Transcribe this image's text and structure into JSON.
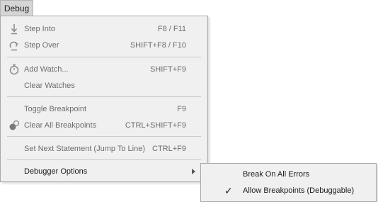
{
  "menubar": {
    "title": "Debug"
  },
  "menu": {
    "items": [
      {
        "label": "Step Into",
        "shortcut": "F8 / F11",
        "icon": "step-into-icon",
        "enabled": false
      },
      {
        "label": "Step Over",
        "shortcut": "SHIFT+F8 / F10",
        "icon": "step-over-icon",
        "enabled": false
      },
      {
        "label": "Add Watch...",
        "shortcut": "SHIFT+F9",
        "icon": "stopwatch-icon",
        "enabled": false
      },
      {
        "label": "Clear Watches",
        "shortcut": "",
        "icon": "",
        "enabled": false
      },
      {
        "label": "Toggle Breakpoint",
        "shortcut": "F9",
        "icon": "",
        "enabled": false
      },
      {
        "label": "Clear All Breakpoints",
        "shortcut": "CTRL+SHIFT+F9",
        "icon": "clear-breakpoints-icon",
        "enabled": false
      },
      {
        "label": "Set Next Statement (Jump To Line)",
        "shortcut": "CTRL+F9",
        "icon": "",
        "enabled": false
      },
      {
        "label": "Debugger Options",
        "shortcut": "",
        "icon": "",
        "enabled": true,
        "has_submenu": true
      }
    ]
  },
  "submenu": {
    "items": [
      {
        "label": "Break On All Errors",
        "checked": false
      },
      {
        "label": "Allow Breakpoints (Debuggable)",
        "checked": true
      }
    ],
    "check_glyph": "✓"
  }
}
